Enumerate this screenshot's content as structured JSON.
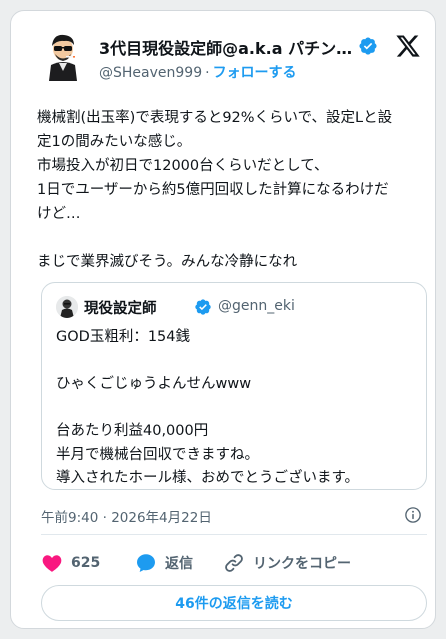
{
  "tweet": {
    "author": {
      "name": "3代目現役設定師@a.k.a パチンコ...",
      "handle": "@SHeaven999",
      "separator": "·",
      "follow_label": "フォローする"
    },
    "text_lines": [
      "機械割(出玉率)で表現すると92%くらいで、設定Lと設",
      "定1の間みたいな感じ。",
      "市場投入が初日で12000台くらいだとして、",
      "1日でユーザーから約5億円回収した計算になるわけだ",
      "けど…",
      "",
      "まじで業界滅びそう。みんな冷静になれ"
    ],
    "quoted": {
      "name": "現役設定師",
      "handle": "@genn_eki",
      "text_lines": [
        "GOD玉粗利：154銭",
        "",
        "ひゃくごじゅうよんせんwww",
        "",
        "台あたり利益40,000円",
        "半月で機械台回収できますね。",
        "導入されたホール様、おめでとうございます。"
      ]
    },
    "timestamp": "午前9:40 · 2026年4月22日",
    "actions": {
      "like_count": "625",
      "reply_label": "返信",
      "copy_link_label": "リンクをコピー"
    },
    "read_replies_label": "46件の返信を読む"
  },
  "colors": {
    "accent": "#1d9bf0",
    "like": "#f91880",
    "text": "#0f1419",
    "muted": "#536471"
  },
  "icons": [
    "avatar-illustration",
    "verified-badge-icon",
    "x-logo-icon",
    "info-icon",
    "heart-icon",
    "reply-bubble-icon",
    "link-icon"
  ]
}
